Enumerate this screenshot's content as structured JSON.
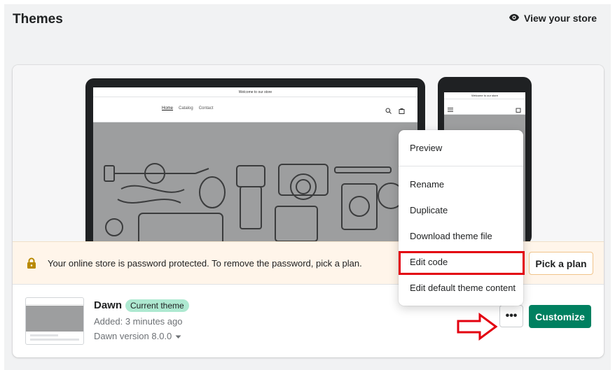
{
  "header": {
    "title": "Themes",
    "view_store_label": "View your store"
  },
  "preview": {
    "announcement": "Welcome to our store",
    "nav_links": [
      "Home",
      "Catalog",
      "Contact"
    ]
  },
  "banner": {
    "message": "Your online store is password protected. To remove the password, pick a plan.",
    "pick_plan_label": "Pick a plan",
    "bg_color": "#fff5ea"
  },
  "theme": {
    "name": "Dawn",
    "badge": "Current theme",
    "added": "Added: 3 minutes ago",
    "version": "Dawn version 8.0.0",
    "more_label": "•••",
    "customize_label": "Customize",
    "customize_color": "#008060"
  },
  "menu": {
    "items": [
      "Preview",
      "Rename",
      "Duplicate",
      "Download theme file",
      "Edit code",
      "Edit default theme content"
    ],
    "highlighted": "Edit code",
    "highlight_color": "#e3000f"
  }
}
